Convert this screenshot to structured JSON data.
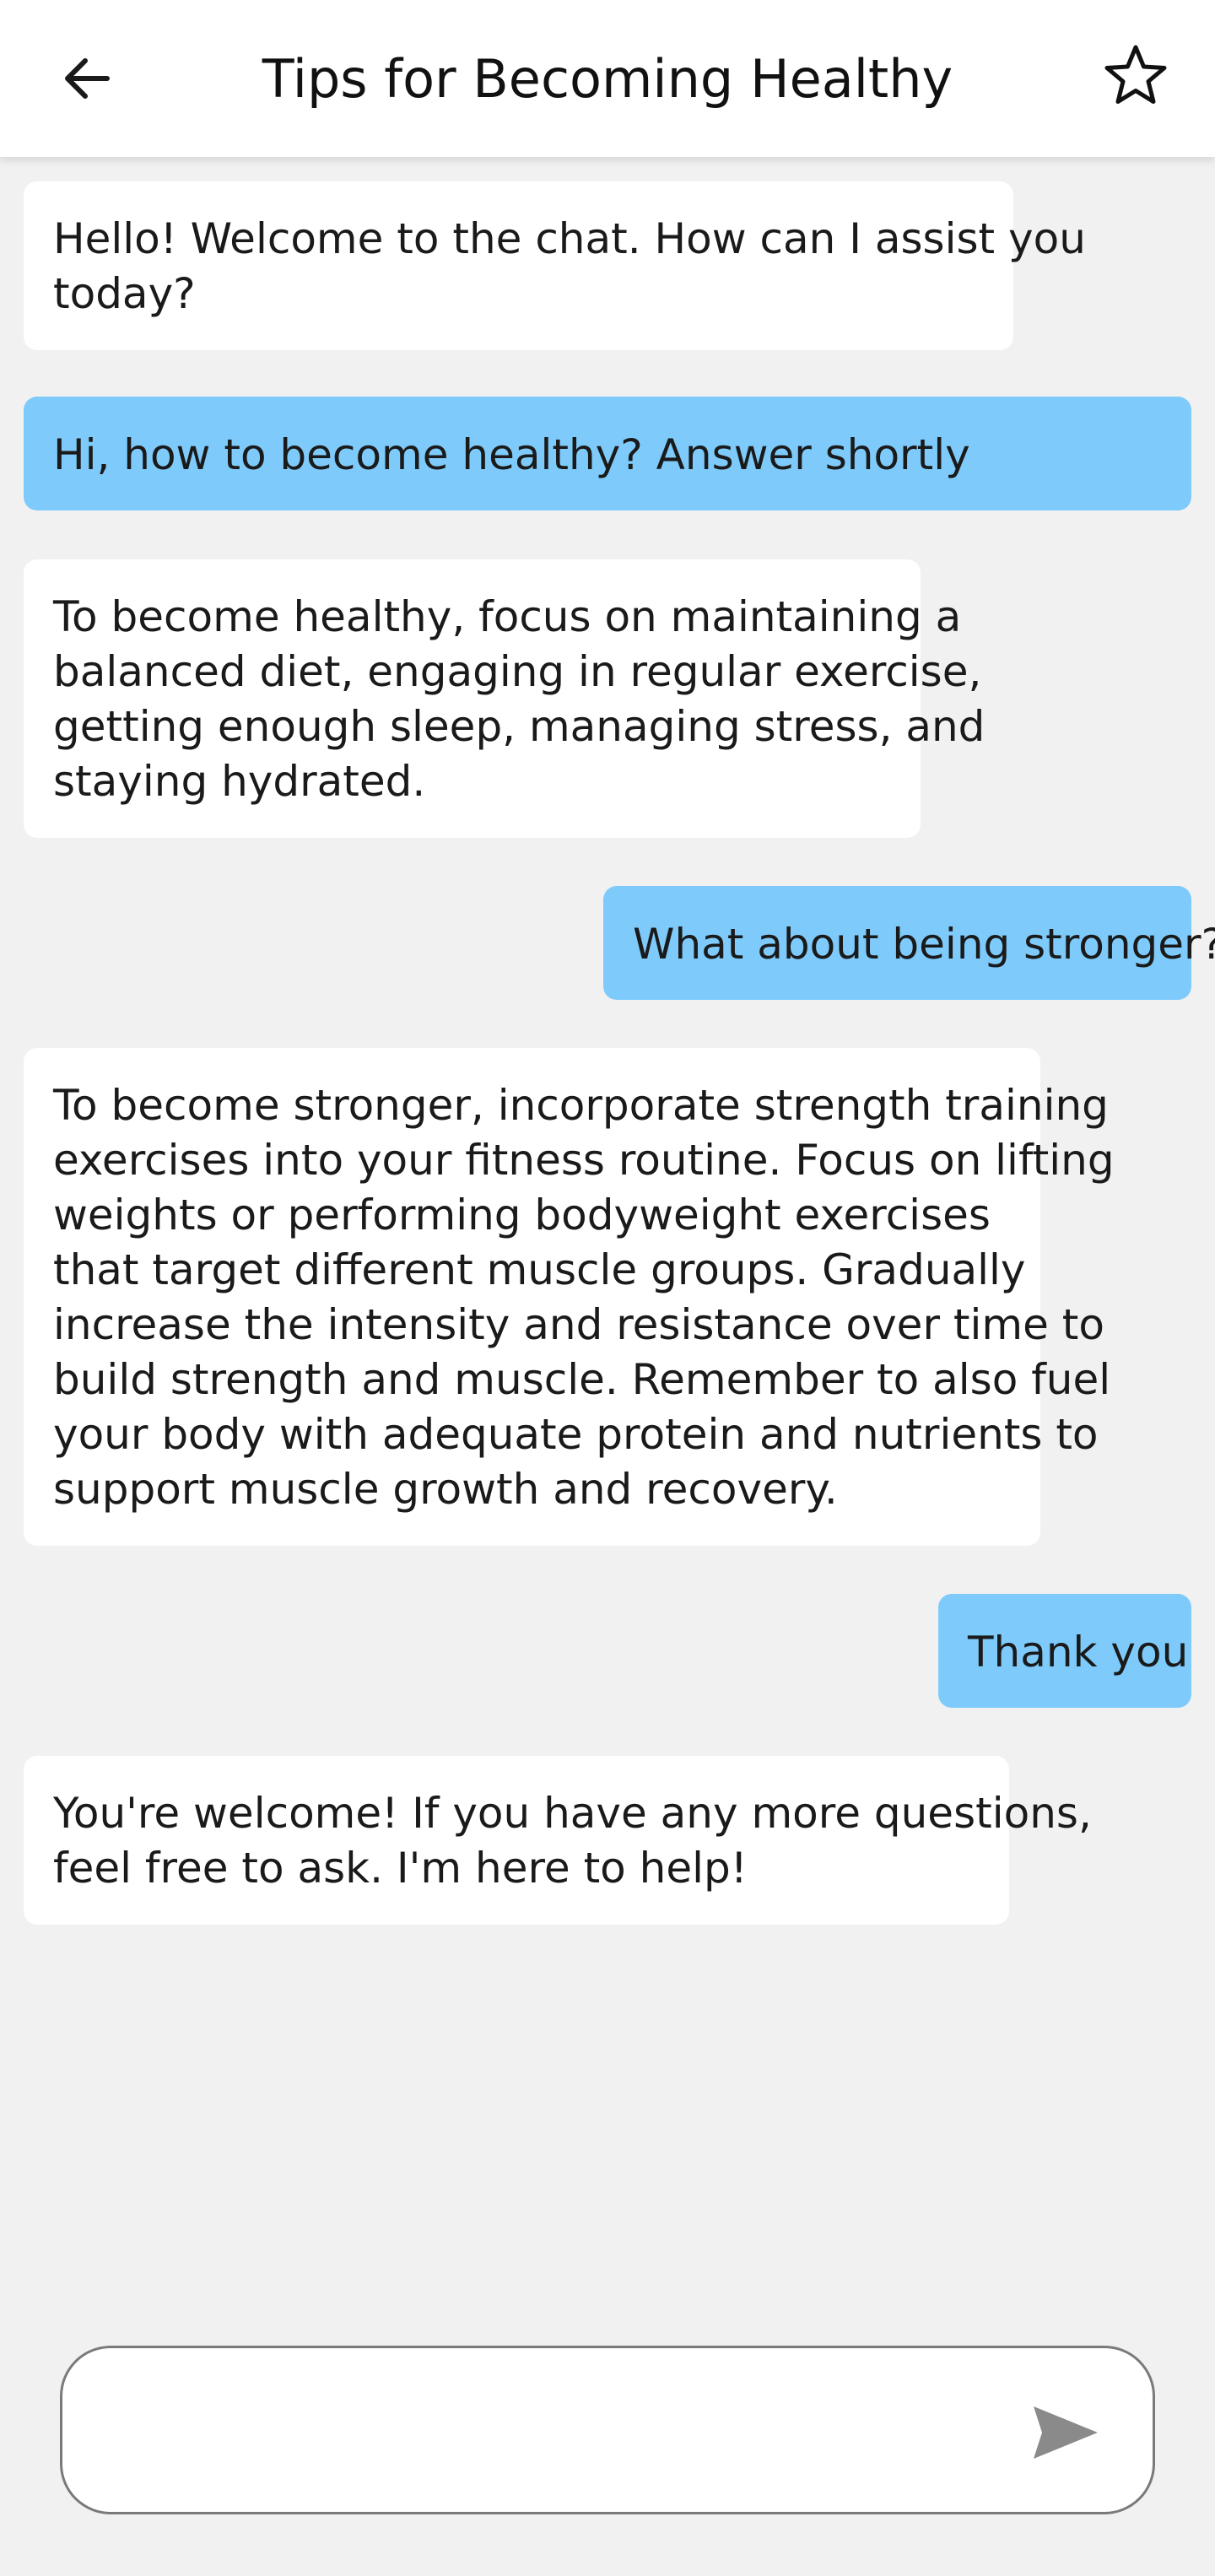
{
  "header": {
    "title": "Tips for Becoming Healthy",
    "back_icon": "arrow-left-icon",
    "favorite_icon": "star-outline-icon"
  },
  "messages": [
    {
      "sender": "bot",
      "lines": [
        "Hello! Welcome to the chat. How can I assist you",
        "today?"
      ]
    },
    {
      "sender": "user",
      "lines": [
        "Hi, how to become healthy? Answer shortly"
      ]
    },
    {
      "sender": "bot",
      "lines": [
        "To become healthy, focus on maintaining a",
        "balanced diet, engaging in regular exercise,",
        "getting enough sleep, managing stress, and",
        "staying hydrated."
      ]
    },
    {
      "sender": "user",
      "lines": [
        "What about being stronger?"
      ]
    },
    {
      "sender": "bot",
      "lines": [
        "To become stronger, incorporate strength training",
        "exercises into your fitness routine. Focus on lifting",
        "weights or performing bodyweight exercises",
        "that target different muscle groups. Gradually",
        "increase the intensity and resistance over time to",
        "build strength and muscle. Remember to also fuel",
        "your body with adequate protein and nutrients to",
        "support muscle growth and recovery."
      ]
    },
    {
      "sender": "user",
      "lines": [
        "Thank you"
      ]
    },
    {
      "sender": "bot",
      "lines": [
        "You're welcome! If you have any more questions,",
        "feel free to ask. I'm here to help!"
      ]
    }
  ],
  "composer": {
    "input_value": "",
    "placeholder": "",
    "send_icon": "send-icon"
  },
  "colors": {
    "background": "#f1f1f1",
    "bot_bubble": "#ffffff",
    "user_bubble": "#7ecbfb",
    "header": "#ffffff",
    "icon_gray": "#8a8a8a"
  }
}
